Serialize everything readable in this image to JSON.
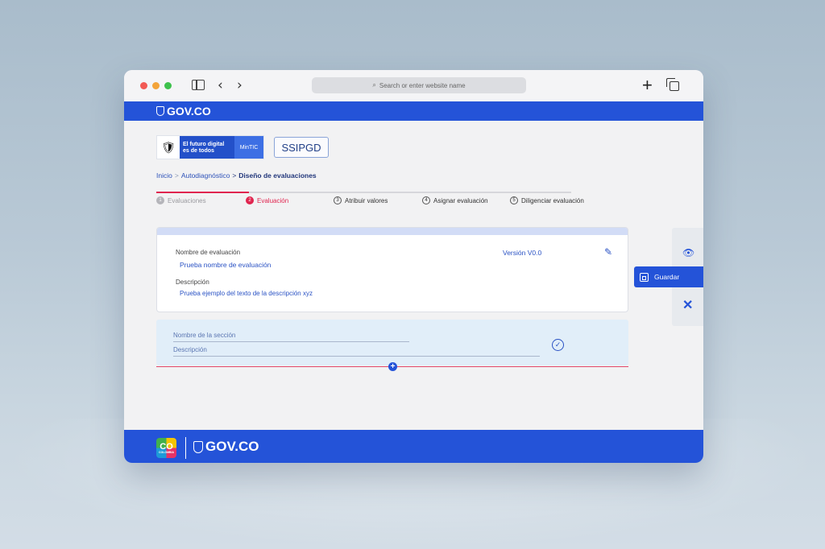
{
  "browser": {
    "url_placeholder": "Search or enter website name",
    "traffic_colors": [
      "#f25a55",
      "#f3a43a",
      "#3dc14c"
    ]
  },
  "gov_header": {
    "logo_text": "GOV.CO"
  },
  "brand": {
    "mintic_tagline": "El futuro digital es de todos",
    "mintic_name": "MinTIC",
    "app_name": "SSIPGD"
  },
  "breadcrumb": {
    "items": [
      "Inicio",
      "Autodiagnóstico",
      "Diseño de evaluaciones"
    ],
    "separator": ">"
  },
  "stepper": {
    "steps": [
      {
        "number": "1",
        "label": "Evaluaciones",
        "state": "done"
      },
      {
        "number": "2",
        "label": "Evaluación",
        "state": "active"
      },
      {
        "number": "3",
        "label": "Atribuir valores",
        "state": "pending"
      },
      {
        "number": "4",
        "label": "Asignar evaluación",
        "state": "pending"
      },
      {
        "number": "5",
        "label": "Diligenciar evaluación",
        "state": "pending"
      }
    ]
  },
  "evaluation": {
    "name_label": "Nombre de evaluación",
    "name_value": "Prueba nombre de evaluación",
    "version": "Versión V0.0",
    "description_label": "Descripción",
    "description_value": "Prueba ejemplo del texto de la descripción xyz"
  },
  "section": {
    "name_placeholder": "Nombre de la sección",
    "description_placeholder": "Descripción"
  },
  "side_actions": {
    "save_label": "Guardar"
  },
  "footer": {
    "co_text": "CO",
    "co_sub": "COLOMBIA",
    "logo_text": "GOV.CO"
  },
  "colors": {
    "gov_blue": "#2453d8",
    "active_step": "#e0254f",
    "link_blue": "#2a52c4"
  }
}
